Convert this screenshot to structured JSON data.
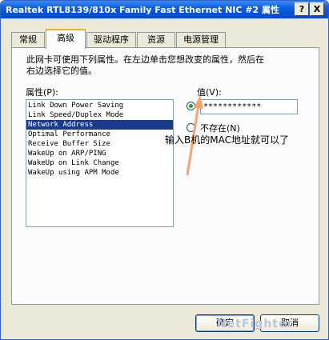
{
  "window": {
    "title": "Realtek RTL8139/810x Family Fast Ethernet NIC #2 属性",
    "help_button": "?",
    "close_button": "X"
  },
  "tabs": [
    {
      "label": "常规",
      "active": false
    },
    {
      "label": "高级",
      "active": true
    },
    {
      "label": "驱动程序",
      "active": false
    },
    {
      "label": "资源",
      "active": false
    },
    {
      "label": "电源管理",
      "active": false
    }
  ],
  "advanced": {
    "description_line1": "此网卡可使用下列属性。在左边单击您想改变的属性，然后在",
    "description_line2": "右边选择它的值。",
    "property_label": "属性(P):",
    "value_label": "值(V):",
    "properties": [
      "Link Down Power Saving",
      "Link Speed/Duplex Mode",
      "Network Address",
      "Optimal Performance",
      "Receive Buffer Size",
      "WakeUp on ARP/PING",
      "WakeUp on Link Change",
      "WakeUp using APM Mode"
    ],
    "selected_property_index": 2,
    "value_input": "************",
    "value_radio_selected": true,
    "not_present_label": "不存在(N)",
    "not_present_selected": false
  },
  "annotation": {
    "text": "输入B机的MAC地址就可以了",
    "arrow_color": "#f7a36b"
  },
  "footer": {
    "ok_label": "确定",
    "cancel_label": "取消"
  },
  "watermark": "NetFighter"
}
